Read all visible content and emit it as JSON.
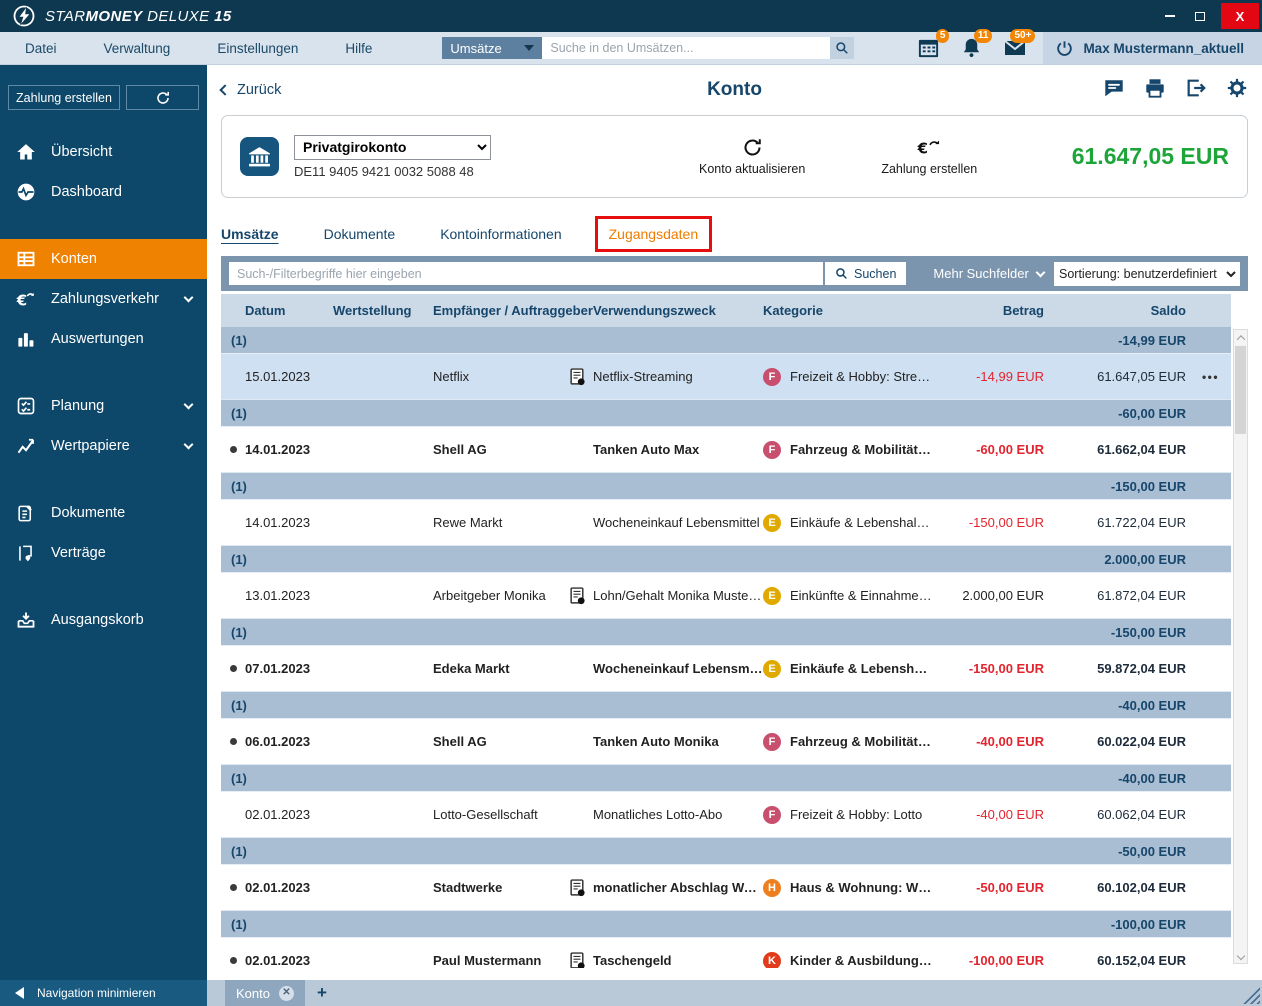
{
  "titlebar": {
    "brand": {
      "star": "STAR",
      "money": "MONEY",
      "deluxe": "DELUXE",
      "version": "15"
    }
  },
  "menubar": {
    "items": [
      "Datei",
      "Verwaltung",
      "Einstellungen",
      "Hilfe"
    ],
    "scope": "Umsätze",
    "search_placeholder": "Suche in den Umsätzen...",
    "calendar_badge": "5",
    "bell_badge": "11",
    "mail_badge": "50+",
    "user": "Max Mustermann_aktuell"
  },
  "sidebar": {
    "create_payment": "Zahlung erstellen",
    "items": {
      "uebersicht": "Übersicht",
      "dashboard": "Dashboard",
      "konten": "Konten",
      "zahlungsverkehr": "Zahlungsverkehr",
      "auswertungen": "Auswertungen",
      "planung": "Planung",
      "wertpapiere": "Wertpapiere",
      "dokumente": "Dokumente",
      "vertraege": "Verträge",
      "ausgangskorb": "Ausgangskorb"
    },
    "minimize": "Navigation minimieren"
  },
  "page": {
    "back": "Zurück",
    "title": "Konto"
  },
  "account": {
    "name": "Privatgirokonto",
    "iban": "DE11 9405 9421 0032 5088 48",
    "update_label": "Konto aktualisieren",
    "payment_label": "Zahlung erstellen",
    "balance": "61.647,05 EUR"
  },
  "tabs": {
    "umsaetze": "Umsätze",
    "dokumente": "Dokumente",
    "kontoinformationen": "Kontoinformationen",
    "zugangsdaten": "Zugangsdaten"
  },
  "filter": {
    "placeholder": "Such-/Filterbegriffe hier eingeben",
    "search_label": "Suchen",
    "more_label": "Mehr Suchfelder",
    "sort_label": "Sortierung: benutzerdefiniert"
  },
  "table": {
    "columns": [
      "Datum",
      "Wertstellung",
      "Empfänger / Auftraggeber",
      "Verwendungszweck",
      "Kategorie",
      "Betrag",
      "Saldo"
    ],
    "row_menu": "•••",
    "groups": [
      {
        "count": "(1)",
        "saldo": "-14,99 EUR",
        "row": {
          "date": "15.01.2023",
          "unread": false,
          "selected": true,
          "payee": "Netflix",
          "doc": true,
          "purpose": "Netflix-Streaming",
          "cat_letter": "F",
          "cat_color": "#c84f6e",
          "category": "Freizeit & Hobby: Stre…",
          "amount": "-14,99 EUR",
          "saldo": "61.647,05 EUR",
          "menu": true
        }
      },
      {
        "count": "(1)",
        "saldo": "-60,00 EUR",
        "row": {
          "date": "14.01.2023",
          "unread": true,
          "selected": false,
          "payee": "Shell AG",
          "doc": false,
          "purpose": "Tanken Auto Max",
          "cat_letter": "F",
          "cat_color": "#c84f6e",
          "category": "Fahrzeug & Mobilität:…",
          "amount": "-60,00 EUR",
          "saldo": "61.662,04 EUR",
          "menu": false
        }
      },
      {
        "count": "(1)",
        "saldo": "-150,00 EUR",
        "row": {
          "date": "14.01.2023",
          "unread": false,
          "selected": false,
          "payee": "Rewe Markt",
          "doc": false,
          "purpose": "Wocheneinkauf Lebensmittel",
          "cat_letter": "E",
          "cat_color": "#dfa900",
          "category": "Einkäufe & Lebenshalt…",
          "amount": "-150,00 EUR",
          "saldo": "61.722,04 EUR",
          "menu": false
        }
      },
      {
        "count": "(1)",
        "saldo": "2.000,00 EUR",
        "row": {
          "date": "13.01.2023",
          "unread": false,
          "selected": false,
          "payee": "Arbeitgeber Monika",
          "doc": true,
          "purpose": "Lohn/Gehalt Monika Muster…",
          "cat_letter": "E",
          "cat_color": "#dfa900",
          "category": "Einkünfte & Einnahme…",
          "amount": "2.000,00 EUR",
          "saldo": "61.872,04 EUR",
          "menu": false
        }
      },
      {
        "count": "(1)",
        "saldo": "-150,00 EUR",
        "row": {
          "date": "07.01.2023",
          "unread": true,
          "selected": false,
          "payee": "Edeka Markt",
          "doc": false,
          "purpose": "Wocheneinkauf Lebensmi…",
          "cat_letter": "E",
          "cat_color": "#dfa900",
          "category": "Einkäufe & Lebensha…",
          "amount": "-150,00 EUR",
          "saldo": "59.872,04 EUR",
          "menu": false
        }
      },
      {
        "count": "(1)",
        "saldo": "-40,00 EUR",
        "row": {
          "date": "06.01.2023",
          "unread": true,
          "selected": false,
          "payee": "Shell AG",
          "doc": false,
          "purpose": "Tanken Auto Monika",
          "cat_letter": "F",
          "cat_color": "#c84f6e",
          "category": "Fahrzeug & Mobilität:…",
          "amount": "-40,00 EUR",
          "saldo": "60.022,04 EUR",
          "menu": false
        }
      },
      {
        "count": "(1)",
        "saldo": "-40,00 EUR",
        "row": {
          "date": "02.01.2023",
          "unread": false,
          "selected": false,
          "payee": "Lotto-Gesellschaft",
          "doc": false,
          "purpose": "Monatliches Lotto-Abo",
          "cat_letter": "F",
          "cat_color": "#c84f6e",
          "category": "Freizeit & Hobby: Lotto",
          "amount": "-40,00 EUR",
          "saldo": "60.062,04 EUR",
          "menu": false
        }
      },
      {
        "count": "(1)",
        "saldo": "-50,00 EUR",
        "row": {
          "date": "02.01.2023",
          "unread": true,
          "selected": false,
          "payee": "Stadtwerke",
          "doc": true,
          "purpose": "monatlicher Abschlag Wa…",
          "cat_letter": "H",
          "cat_color": "#ee7f1f",
          "category": "Haus & Wohnung: W…",
          "amount": "-50,00 EUR",
          "saldo": "60.102,04 EUR",
          "menu": false
        }
      },
      {
        "count": "(1)",
        "saldo": "-100,00 EUR",
        "row": {
          "date": "02.01.2023",
          "unread": true,
          "selected": false,
          "payee": "Paul Mustermann",
          "doc": true,
          "purpose": "Taschengeld",
          "cat_letter": "K",
          "cat_color": "#e23b1c",
          "category": "Kinder & Ausbildung…",
          "amount": "-100,00 EUR",
          "saldo": "60.152,04 EUR",
          "menu": false
        }
      }
    ]
  },
  "bottombar": {
    "tab": "Konto",
    "new_tab": "+"
  },
  "colors": {
    "accent_orange": "#ef8200",
    "negative_red": "#e3242e",
    "balance_green": "#1ea53a",
    "highlight_red": "#e60e0e",
    "sidebar_blue": "#0d4769",
    "filterbar_blue": "#7b95ae"
  }
}
